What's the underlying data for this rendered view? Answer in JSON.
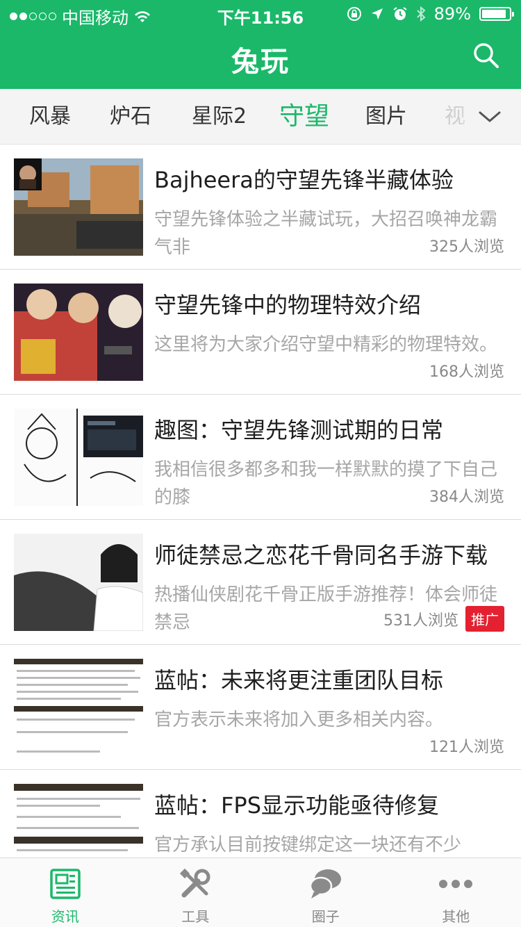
{
  "colors": {
    "brand": "#1bb86a",
    "promo": "#e32130",
    "muted_text": "#a6a6a6"
  },
  "status_bar": {
    "carrier": "中国移动",
    "time": "下午11:56",
    "battery": "89%",
    "signal_bars_filled": 2,
    "signal_bars_total": 5,
    "battery_level": 0.89
  },
  "header": {
    "title": "兔玩",
    "search_icon": "search-icon"
  },
  "category_tabs": [
    {
      "label": "风暴",
      "active": false
    },
    {
      "label": "炉石",
      "active": false
    },
    {
      "label": "星际2",
      "active": false
    },
    {
      "label": "守望",
      "active": true
    },
    {
      "label": "图片",
      "active": false
    },
    {
      "label": "视",
      "active": false
    }
  ],
  "articles": [
    {
      "title": "Bajheera的守望先锋半藏体验",
      "desc": "守望先锋体验之半藏试玩，大招召唤神龙霸气非",
      "views": "325人浏览",
      "promo": null,
      "thumb": "game-screenshot"
    },
    {
      "title": "守望先锋中的物理特效介绍",
      "desc": "这里将为大家介绍守望中精彩的物理特效。",
      "views": "168人浏览",
      "promo": null,
      "thumb": "game-screenshot"
    },
    {
      "title": "趣图：守望先锋测试期的日常",
      "desc": "我相信很多都多和我一样默默的摸了下自己的膝",
      "views": "384人浏览",
      "promo": null,
      "thumb": "comic-sketch"
    },
    {
      "title": "师徒禁忌之恋花千骨同名手游下载",
      "desc": "热播仙侠剧花千骨正版手游推荐！体会师徒禁忌",
      "views": "531人浏览",
      "promo": "推广",
      "thumb": "portrait-photo"
    },
    {
      "title": "蓝帖：未来将更注重团队目标",
      "desc": "官方表示未来将加入更多相关内容。",
      "views": "121人浏览",
      "promo": null,
      "thumb": "text-screenshot"
    },
    {
      "title": "蓝帖：FPS显示功能亟待修复",
      "desc": "官方承认目前按键绑定这一块还有不少",
      "views": "",
      "promo": null,
      "thumb": "text-screenshot"
    }
  ],
  "bottom_tabs": [
    {
      "label": "资讯",
      "icon": "news-icon",
      "active": true
    },
    {
      "label": "工具",
      "icon": "tools-icon",
      "active": false
    },
    {
      "label": "圈子",
      "icon": "chat-bubbles-icon",
      "active": false
    },
    {
      "label": "其他",
      "icon": "more-icon",
      "active": false
    }
  ]
}
